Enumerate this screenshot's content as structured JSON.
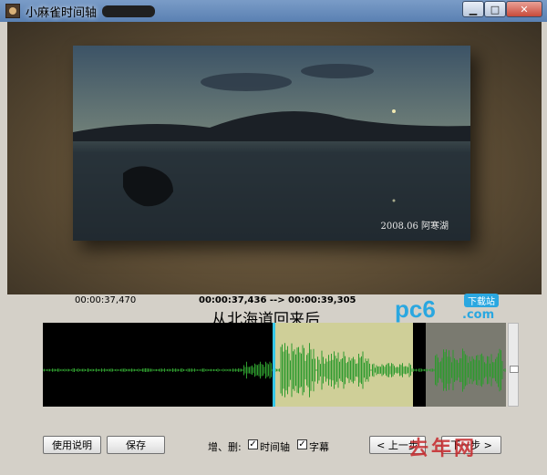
{
  "window": {
    "title": "小麻雀时间轴"
  },
  "photo": {
    "caption": "2008.06  阿寒湖"
  },
  "playback": {
    "current_time": "00:00:37,470",
    "range": "00:00:37,436 --> 00:00:39,305",
    "subtitle_text": "从北海道回来后"
  },
  "logo": {
    "main": "pc6",
    "badge": "下载站",
    "suffix": ".com"
  },
  "controls": {
    "help_label": "使用说明",
    "save_label": "保存",
    "edit_label": "增、删:",
    "timeline_checkbox_label": "时间轴",
    "timeline_checked": true,
    "subtitle_checkbox_label": "字幕",
    "subtitle_checked": true,
    "prev_label": "< 上一步",
    "next_label": "下一步 >"
  },
  "watermark": {
    "text": "去年网"
  },
  "colors": {
    "wave": "#2e9a2e",
    "selection": "#cfcf98",
    "cursor": "#35c7e8",
    "gray_region": "#7a7a70"
  }
}
